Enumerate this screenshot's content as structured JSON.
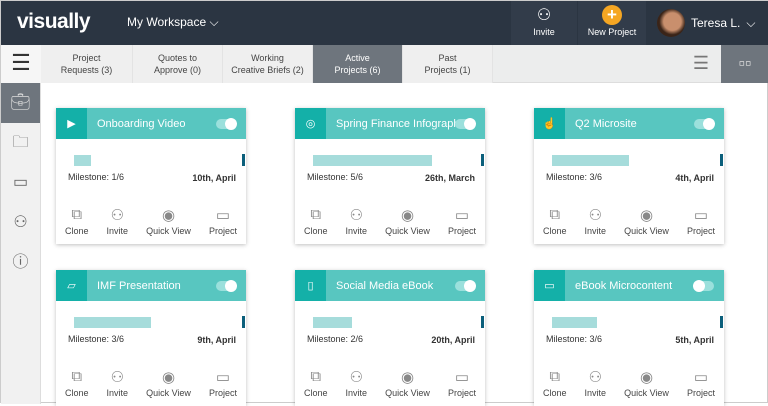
{
  "header": {
    "logo": "visually",
    "workspace": "My Workspace",
    "invite": "Invite",
    "new_project": "New Project",
    "user": "Teresa L."
  },
  "tabs": [
    {
      "label1": "Project",
      "label2": "Requests (3)"
    },
    {
      "label1": "Quotes to",
      "label2": "Approve (0)"
    },
    {
      "label1": "Working",
      "label2": "Creative Briefs (2)"
    },
    {
      "label1": "Active",
      "label2": "Projects (6)"
    },
    {
      "label1": "Past",
      "label2": "Projects (1)"
    }
  ],
  "actions": {
    "clone": "Clone",
    "invite": "Invite",
    "quick_view": "Quick View",
    "project": "Project"
  },
  "cards": [
    {
      "title": "Onboarding Video",
      "milestone": "Milestone: 1/6",
      "date": "10th, April",
      "progress": 0.11,
      "enabled": true,
      "icon": "play-icon"
    },
    {
      "title": "Spring Finance Infographic",
      "milestone": "Milestone: 5/6",
      "date": "26th, March",
      "progress": 0.77,
      "enabled": true,
      "icon": "venn-icon"
    },
    {
      "title": "Q2 Microsite",
      "milestone": "Milestone: 3/6",
      "date": "4th, April",
      "progress": 0.5,
      "enabled": true,
      "icon": "touch-icon"
    },
    {
      "title": "IMF Presentation",
      "milestone": "Milestone: 3/6",
      "date": "9th, April",
      "progress": 0.5,
      "enabled": true,
      "icon": "presentation-icon"
    },
    {
      "title": "Social Media eBook",
      "milestone": "Milestone: 2/6",
      "date": "20th, April",
      "progress": 0.25,
      "enabled": true,
      "icon": "ebook-icon"
    },
    {
      "title": "eBook Microcontent",
      "milestone": "Milestone: 3/6",
      "date": "5th, April",
      "progress": 0.29,
      "enabled": false,
      "icon": "card-icon"
    }
  ]
}
